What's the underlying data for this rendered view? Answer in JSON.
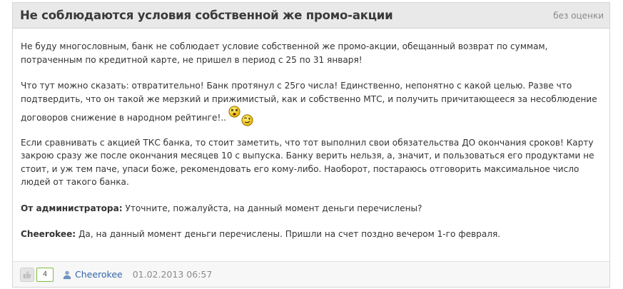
{
  "review": {
    "title": "Не соблюдаются условия собственной же промо-акции",
    "rating_label": "без оценки",
    "paragraphs": {
      "p1": "Не буду многословным, банк не соблюдает условие собственной же промо-акции, обещанный возврат по суммам, потраченным по кредитной карте, не пришел в период с 25 по 31 января!",
      "p2": "Что тут можно сказать: отвратительно! Банк протянул с 25го числа! Единственно, непонятно с какой целью. Разве что подтвердить, что он такой же мерзкий и прижимистый, как и собственно МТС, и получить причитающееся за несоблюдение договоров снижение в народном рейтинге!..",
      "p3": "Если сравнивать с акцией ТКС банка, то стоит заметить, что тот выполнил свои обязательства ДО окончания сроков! Карту закрою сразу же после окончания месяцев 10 с выпуска. Банку верить нельзя, а, значит, и пользоваться его продуктами не стоит, и уж тем паче, упаси боже, рекомендовать его кому-либо. Наоборот, постараюсь отговорить максимальное число людей от такого банка."
    },
    "admin_reply": {
      "label": "От администратора:",
      "text": "Уточните, пожалуйста, на данный момент деньги перечислены?"
    },
    "author_reply": {
      "label": "Cheerokee:",
      "text": "Да, на данный момент деньги перечислены. Пришли на счет поздно вечером 1-го февраля."
    }
  },
  "footer": {
    "like_count": "4",
    "author": "Cheerokee",
    "date": "01.02.2013 06:57"
  },
  "colors": {
    "header_bg": "#e9e9e9",
    "link": "#3366aa",
    "like_border": "#7fbf3f"
  },
  "icons": {
    "smiley_1": "dizzy-face-icon",
    "smiley_2": "winking-face-icon",
    "like": "thumbs-up-icon",
    "user": "user-icon"
  }
}
